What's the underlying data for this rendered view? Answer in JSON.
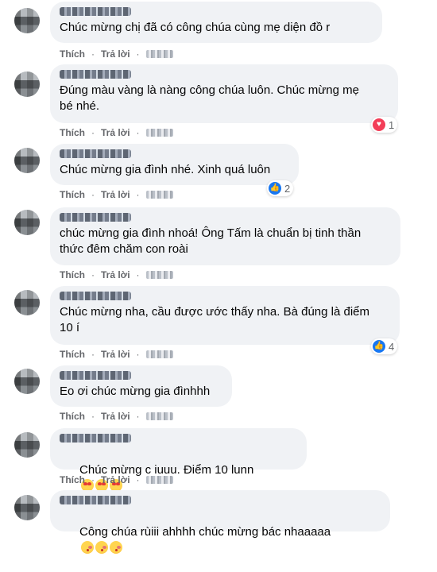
{
  "actions": {
    "like_label": "Thích",
    "reply_label": "Trả lời",
    "separator": "·"
  },
  "colors": {
    "bubble": "#f0f2f5",
    "like": "#1877f2",
    "love": "#f33e58",
    "meta_text": "#65676b"
  },
  "comments": [
    {
      "text": "Chúc mừng chị đã có công chúa cùng mẹ diện đồ r"
    },
    {
      "text": "Đúng màu vàng là nàng công chúa luôn. Chúc mừng mẹ\nbé nhé.",
      "reaction": {
        "icon": "heart-icon",
        "count": "1"
      }
    },
    {
      "text": "Chúc mừng gia đình nhé. Xinh quá luôn",
      "reaction": {
        "icon": "like-icon",
        "count": "2"
      }
    },
    {
      "text": "chúc mừng gia đình nhoá! Ông Tấm là chuẩn bị tinh thần\nthức đêm chăm con roài"
    },
    {
      "text": "Chúc mừng nha, cầu được ước thấy nha. Bà đúng là điểm\n10 í",
      "reaction": {
        "icon": "like-icon",
        "count": "4"
      }
    },
    {
      "text": "Eo ơi chúc mừng gia đìnhhh"
    },
    {
      "text": "Chúc mừng c iuuu. Điểm 10 lunn",
      "emojis": [
        "heart-eyes-emoji",
        "heart-eyes-emoji",
        "heart-eyes-emoji"
      ]
    },
    {
      "text": "Công chúa rùiii ahhhh chúc mừng bác nhaaaaa",
      "emojis": [
        "kissing-emoji",
        "kissing-emoji",
        "kissing-emoji"
      ]
    }
  ]
}
